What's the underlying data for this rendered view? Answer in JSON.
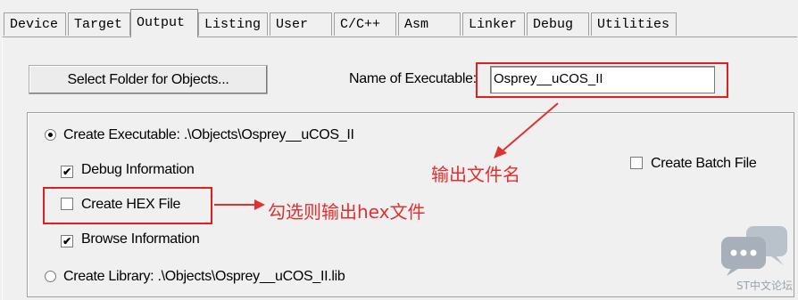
{
  "tabs": [
    {
      "label": "Device",
      "active": false
    },
    {
      "label": "Target",
      "active": false
    },
    {
      "label": "Output",
      "active": true
    },
    {
      "label": "Listing",
      "active": false
    },
    {
      "label": "User",
      "active": false
    },
    {
      "label": "C/C++",
      "active": false
    },
    {
      "label": "Asm",
      "active": false
    },
    {
      "label": "Linker",
      "active": false
    },
    {
      "label": "Debug",
      "active": false
    },
    {
      "label": "Utilities",
      "active": false
    }
  ],
  "output": {
    "select_folder_label": "Select Folder for Objects...",
    "name_of_executable_label": "Name of Executable:",
    "name_of_executable_value": "Osprey__uCOS_II",
    "create_executable": {
      "label": "Create Executable:  .\\Objects\\Osprey__uCOS_II",
      "selected": true
    },
    "debug_information": {
      "label": "Debug Information",
      "checked": true
    },
    "create_hex_file": {
      "label": "Create HEX File",
      "checked": false
    },
    "browse_information": {
      "label": "Browse Information",
      "checked": true
    },
    "create_library": {
      "label": "Create Library:  .\\Objects\\Osprey__uCOS_II.lib",
      "selected": false
    },
    "create_batch_file": {
      "label": "Create Batch File",
      "checked": false
    }
  },
  "annotations": {
    "output_filename": "输出文件名",
    "hex_note": "勾选则输出hex文件",
    "color": "#e03030"
  },
  "watermark": {
    "text": "ST中文论坛",
    "icon": "chat-bubbles-icon"
  }
}
